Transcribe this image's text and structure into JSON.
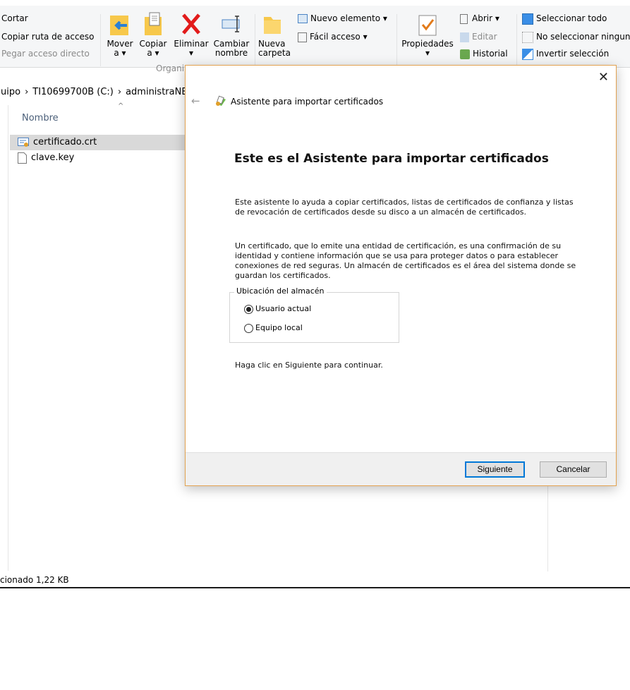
{
  "ribbon": {
    "clipboard": {
      "cut": "Cortar",
      "copy_path": "Copiar ruta de acceso",
      "paste_shortcut": "Pegar acceso directo"
    },
    "organize": {
      "move": "Mover",
      "move_sub": "a ▾",
      "copy": "Copiar",
      "copy_sub": "a ▾",
      "delete": "Eliminar",
      "delete_sub": "▾",
      "rename": "Cambiar",
      "rename_sub": "nombre",
      "group_label": "Organi"
    },
    "new": {
      "new_folder": "Nueva",
      "new_folder_sub": "carpeta",
      "new_item": "Nuevo elemento ▾",
      "easy_access": "Fácil acceso ▾"
    },
    "open": {
      "properties": "Propiedades",
      "properties_sub": "▾",
      "open": "Abrir ▾",
      "edit": "Editar",
      "history": "Historial"
    },
    "select": {
      "select_all": "Seleccionar todo",
      "select_none": "No seleccionar ningun",
      "invert": "Invertir selección"
    }
  },
  "address": {
    "crumb1": "uipo",
    "crumb2": "TI10699700B (C:)",
    "crumb3": "administraNET",
    "sep": "›"
  },
  "filelist": {
    "column_name": "Nombre",
    "sort_indicator": "^",
    "files": [
      {
        "name": "certificado.crt"
      },
      {
        "name": "clave.key"
      }
    ]
  },
  "status": {
    "text": "cionado  1,22 KB"
  },
  "dialog": {
    "close": "✕",
    "back": "←",
    "title": "Asistente para importar certificados",
    "heading": "Este es el Asistente para importar certificados",
    "para1": "Este asistente lo ayuda a copiar certificados, listas de certificados de confianza y listas de revocación de certificados desde su disco a un almacén de certificados.",
    "para2": "Un certificado, que lo emite una entidad de certificación, es una confirmación de su identidad y contiene información que se usa para proteger datos o para establecer conexiones de red seguras. Un almacén de certificados es el área del sistema donde se guardan los certificados.",
    "store_legend": "Ubicación del almacén",
    "radio_current_user": "Usuario actual",
    "radio_local_machine": "Equipo local",
    "selected_store": "Usuario actual",
    "continue_text": "Haga clic en Siguiente para continuar.",
    "next_button": "Siguiente",
    "cancel_button": "Cancelar"
  },
  "colors": {
    "dialog_border": "#e2a250",
    "primary_button_border": "#0078d7",
    "selection": "#d9d9d9"
  }
}
